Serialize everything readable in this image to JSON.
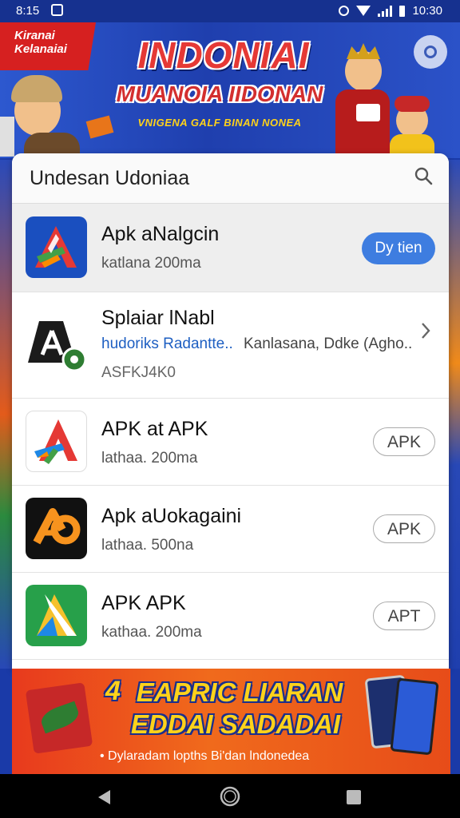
{
  "status_bar": {
    "time": "8:15",
    "clock": "10:30"
  },
  "banner": {
    "brand": "Kiranai Kelanaiai",
    "title": "INDONIAI",
    "subtitle": "MUANOIA IIDONAN",
    "tagline": "VNIGENA GALF BINAN NONEA"
  },
  "search": {
    "query": "Undesan Udoniaa"
  },
  "apps": [
    {
      "name": "Apk aNalgcin",
      "sub": "katlana 200ma",
      "button": "Dy tien"
    },
    {
      "name": "Splaiar lNabl",
      "link": "hudoriks Radantte..",
      "dev": "Kanlasana, Ddke (Agho..",
      "code": "ASFKJ4K0"
    },
    {
      "name": "APK at APK",
      "sub": "lathaa. 200ma",
      "button": "APK"
    },
    {
      "name": "Apk aUokagaini",
      "sub": "lathaa. 500na",
      "button": "APK"
    },
    {
      "name": "APK APK",
      "sub": "kathaa. 200ma",
      "button": "APT"
    }
  ],
  "promo": {
    "number": "4",
    "title1": "EAPRIC LIARAN",
    "title2": "EDDAI SADADAI",
    "footer": "• Dylaradam lopths Bi'dan lndonedea"
  },
  "colors": {
    "accent": "#3e7de0",
    "banner": "#2140b0",
    "promo": "#ec5a1c"
  }
}
